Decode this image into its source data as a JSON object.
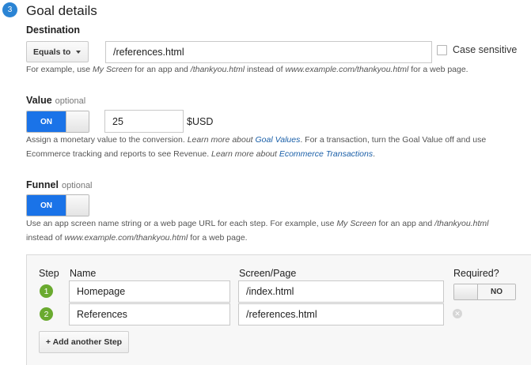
{
  "section": {
    "step_number": "3",
    "title": "Goal details"
  },
  "destination": {
    "label": "Destination",
    "match_type": "Equals to",
    "value": "/references.html",
    "case_sensitive_label": "Case sensitive",
    "case_sensitive_checked": false,
    "help": {
      "p1": "For example, use ",
      "i1": "My Screen",
      "p2": " for an app and ",
      "i2": "/thankyou.html",
      "p3": " instead of ",
      "i3": "www.example.com/thankyou.html",
      "p4": " for a web page."
    }
  },
  "value": {
    "label": "Value",
    "optional": "optional",
    "toggle_state": "ON",
    "amount": "25",
    "currency": "$USD",
    "help": {
      "p1": "Assign a monetary value to the conversion. ",
      "i1": "Learn more about ",
      "link1": "Goal Values",
      "p2": ". For a transaction, turn the Goal Value off and use",
      "p3": "Ecommerce tracking and reports to see Revenue. ",
      "i2": "Learn more about ",
      "link2": "Ecommerce Transactions",
      "p4": "."
    }
  },
  "funnel": {
    "label": "Funnel",
    "optional": "optional",
    "toggle_state": "ON",
    "help": {
      "p1": "Use an app screen name string or a web page URL for each step. For example, use ",
      "i1": "My Screen",
      "p2": " for an app and ",
      "i2": "/thankyou.html",
      "p3": "instead of ",
      "i3": "www.example.com/thankyou.html",
      "p4": " for a web page."
    },
    "columns": {
      "step": "Step",
      "name": "Name",
      "screen": "Screen/Page",
      "required": "Required?"
    },
    "steps": [
      {
        "number": "1",
        "name": "Homepage",
        "screen": "/index.html"
      },
      {
        "number": "2",
        "name": "References",
        "screen": "/references.html"
      }
    ],
    "required_toggle": "NO",
    "add_step_label": "+ Add another Step"
  },
  "colors": {
    "accent_blue": "#1a73e8",
    "badge_blue": "#2b84d4",
    "step_green": "#6aaa2f",
    "link": "#1a5fa8"
  }
}
